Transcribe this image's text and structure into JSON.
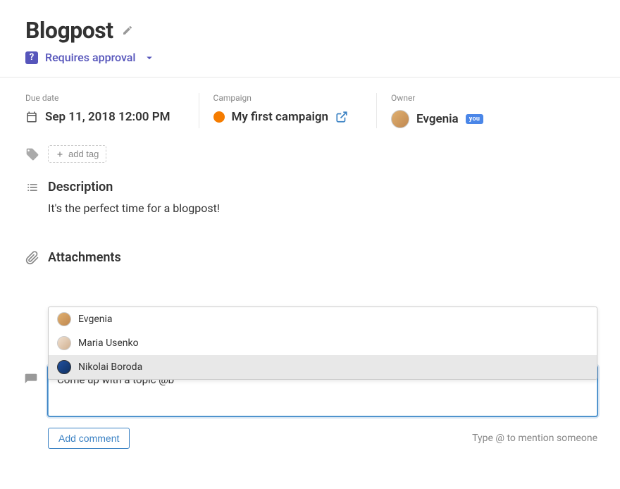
{
  "header": {
    "title": "Blogpost",
    "status_label": "Requires approval"
  },
  "meta": {
    "due_date": {
      "label": "Due date",
      "value": "Sep 11, 2018 12:00 PM"
    },
    "campaign": {
      "label": "Campaign",
      "value": "My first campaign"
    },
    "owner": {
      "label": "Owner",
      "value": "Evgenia",
      "you_badge": "you"
    }
  },
  "tags": {
    "add_label": "add tag"
  },
  "description": {
    "title": "Description",
    "text": "It's the perfect time for a blogpost!"
  },
  "attachments": {
    "title": "Attachments"
  },
  "mention_suggestions": [
    {
      "name": "Evgenia"
    },
    {
      "name": "Maria Usenko"
    },
    {
      "name": "Nikolai Boroda"
    }
  ],
  "comment": {
    "draft": "Come up with a topic @b",
    "button_label": "Add comment",
    "hint": "Type @ to mention someone"
  }
}
